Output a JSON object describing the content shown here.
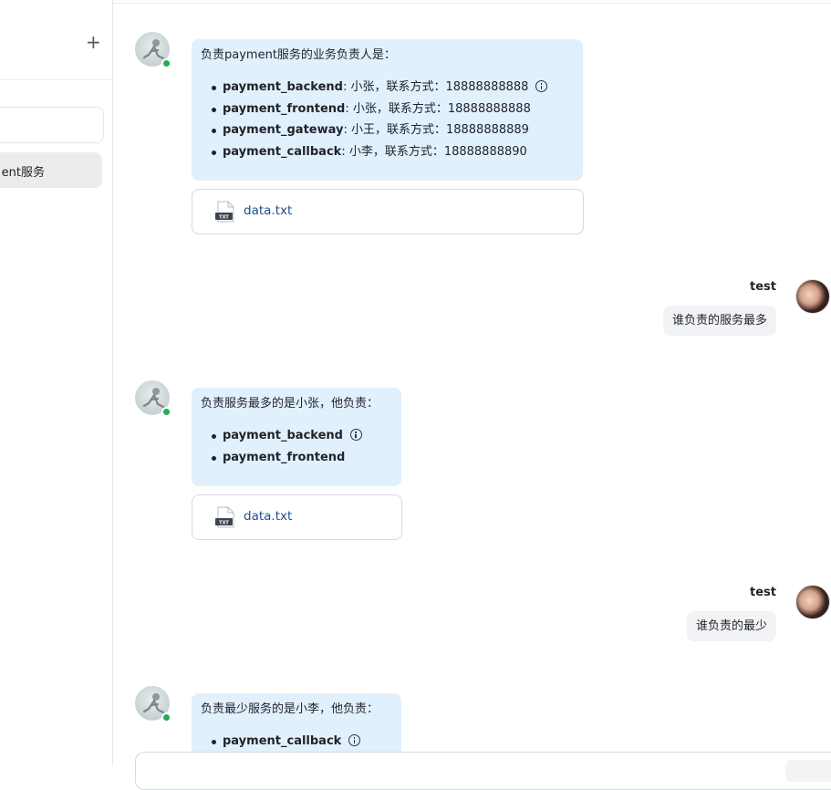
{
  "sidebar": {
    "conversation_label": "ent服务"
  },
  "messages": {
    "bot1": {
      "lead": "负责payment服务的业务负责人是：",
      "items": [
        {
          "name": "payment_backend",
          "detail": ": 小张，联系方式：18888888888"
        },
        {
          "name": "payment_frontend",
          "detail": ": 小张，联系方式：18888888888"
        },
        {
          "name": "payment_gateway",
          "detail": ": 小王，联系方式：18888888889"
        },
        {
          "name": "payment_callback",
          "detail": ": 小李，联系方式：18888888890"
        }
      ],
      "file": "data.txt"
    },
    "user1": {
      "name": "test",
      "text": "谁负责的服务最多"
    },
    "bot2": {
      "lead": "负责服务最多的是小张，他负责：",
      "items": [
        {
          "name": "payment_backend"
        },
        {
          "name": "payment_frontend"
        }
      ],
      "file": "data.txt"
    },
    "user2": {
      "name": "test",
      "text": "谁负责的最少"
    },
    "bot3": {
      "lead": "负责最少服务的是小李，他负责：",
      "items": [
        {
          "name": "payment_callback"
        }
      ]
    }
  },
  "icons": {
    "add": "plus-icon",
    "info": "info-icon",
    "file": "txt-file-icon"
  },
  "colors": {
    "bot_bubble": "#e1f0fd",
    "user_bubble": "#f2f3f5",
    "online": "#1fad55",
    "file_link": "#1e4e8c"
  }
}
